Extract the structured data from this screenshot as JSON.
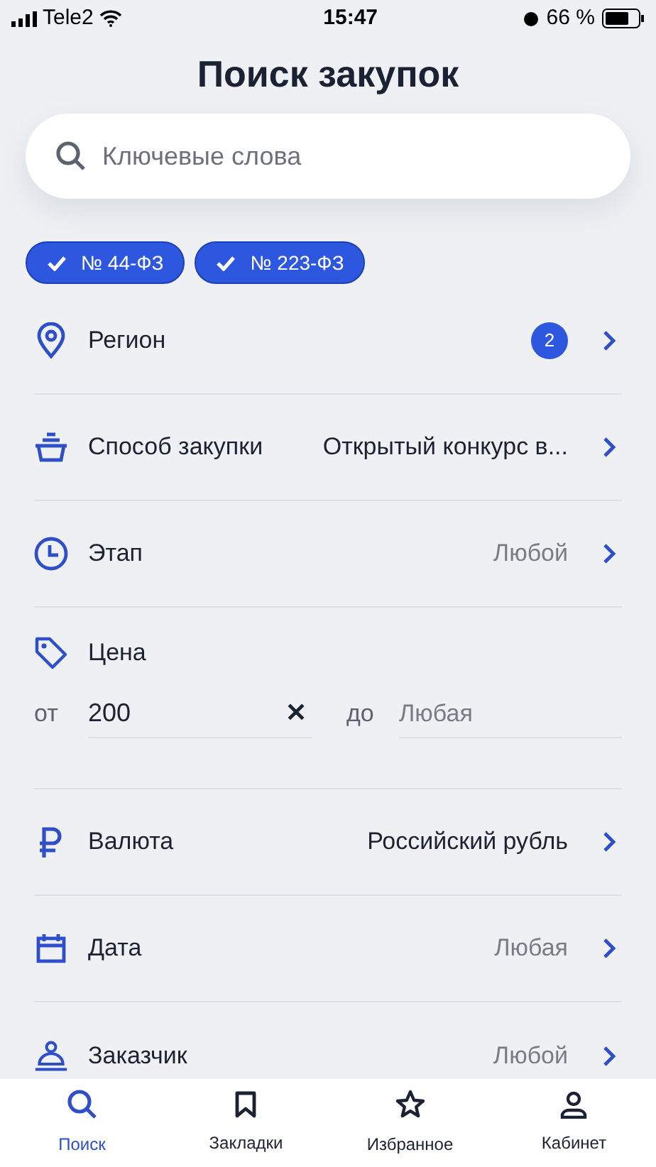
{
  "status_bar": {
    "carrier": "Tele2",
    "time": "15:47",
    "battery": "66 %"
  },
  "title": "Поиск закупок",
  "search": {
    "placeholder": "Ключевые слова"
  },
  "chips": [
    {
      "label": "№ 44-ФЗ",
      "checked": true
    },
    {
      "label": "№ 223-ФЗ",
      "checked": true
    }
  ],
  "filters": [
    {
      "kind": "select",
      "label": "Регион",
      "badge": "2"
    },
    {
      "kind": "select",
      "label": "Способ закупки",
      "value": "Открытый конкурс в...",
      "set": true
    },
    {
      "kind": "select",
      "label": "Этап",
      "value": "Любой",
      "set": false
    },
    {
      "kind": "price",
      "label": "Цена",
      "from_label": "от",
      "from_value": "200",
      "clear": "✕",
      "to_label": "до",
      "to_placeholder": "Любая"
    },
    {
      "kind": "select",
      "label": "Валюта",
      "value": "Российский рубль",
      "set": true
    },
    {
      "kind": "select",
      "label": "Дата",
      "value": "Любая",
      "set": false
    },
    {
      "kind": "select",
      "label": "Заказчик",
      "value": "Любой",
      "set": false
    }
  ],
  "tab_bar": [
    {
      "label": "Поиск",
      "selected": true
    },
    {
      "label": "Закладки",
      "selected": false
    },
    {
      "label": "Избранное",
      "selected": false
    },
    {
      "label": "Кабинет",
      "selected": false
    }
  ]
}
